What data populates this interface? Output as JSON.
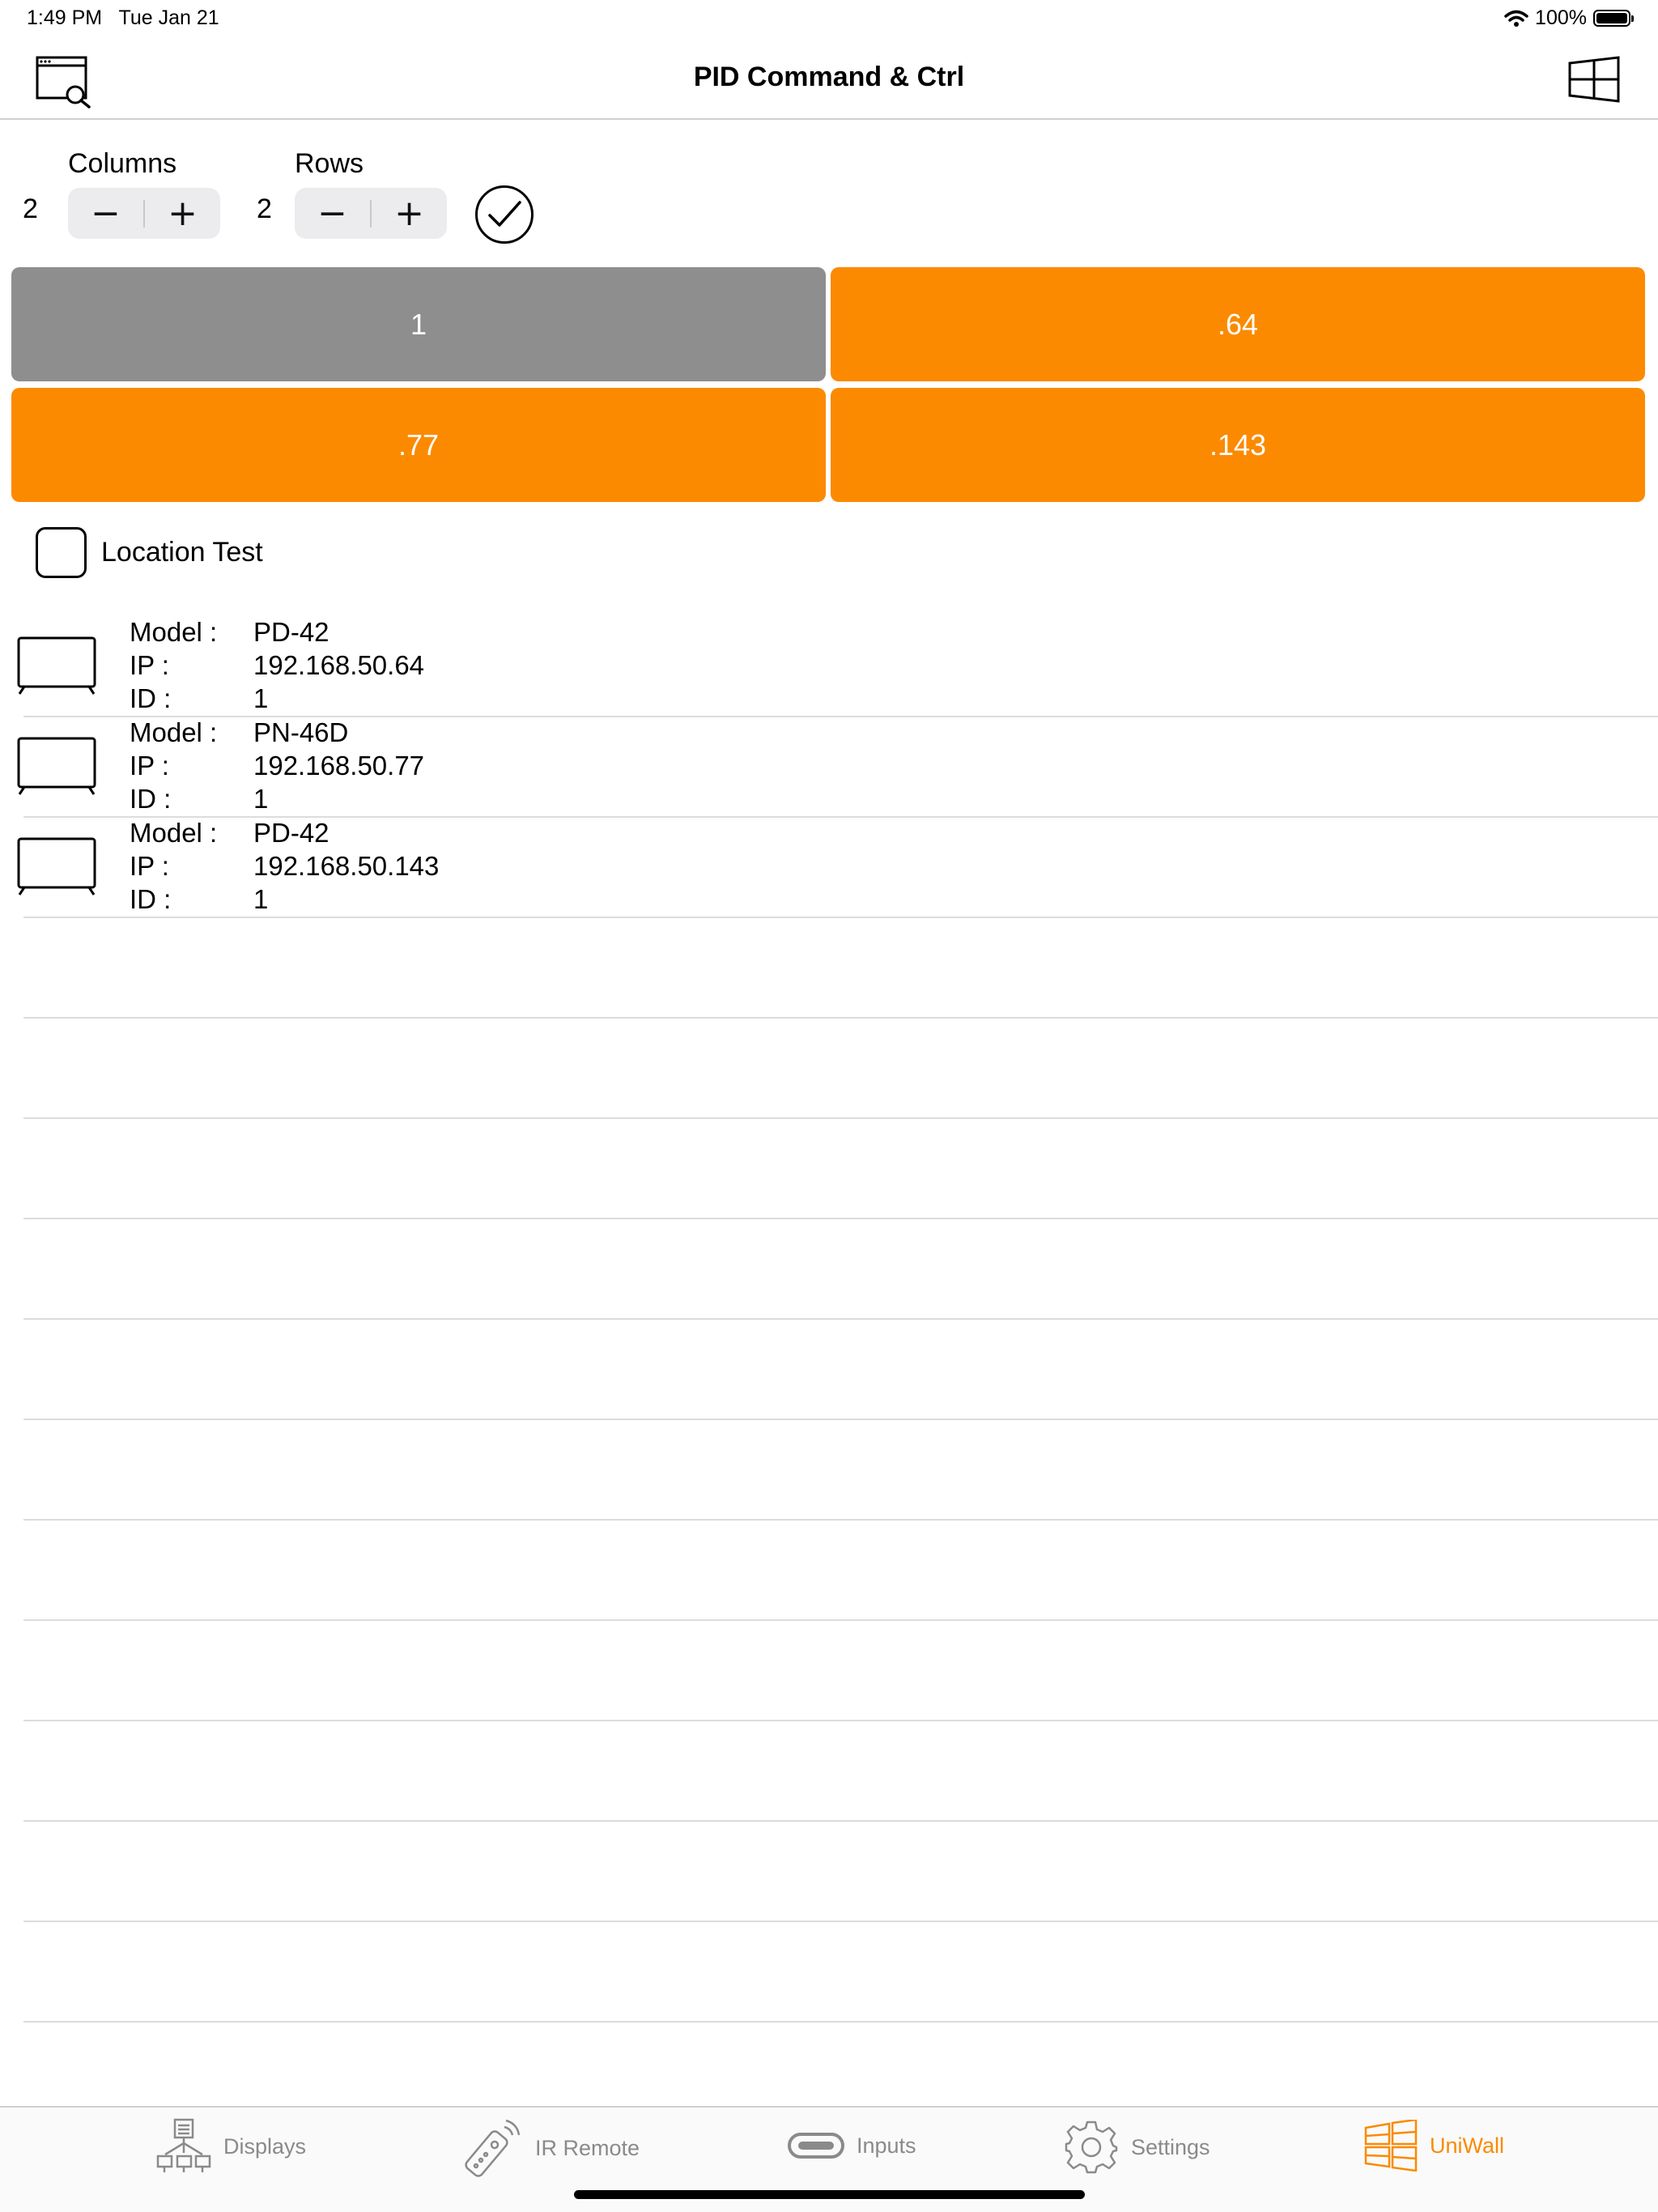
{
  "status": {
    "time": "1:49 PM",
    "date": "Tue Jan 21",
    "battery": "100%"
  },
  "nav": {
    "title": "PID Command & Ctrl",
    "left_icon": "window-search-icon",
    "right_icon": "windows-grid-icon"
  },
  "grid_config": {
    "columns_label": "Columns",
    "columns_value": "2",
    "rows_label": "Rows",
    "rows_value": "2",
    "minus": "−",
    "plus": "+"
  },
  "grid": {
    "cells": [
      {
        "label": "1",
        "color": "#8e8e8e"
      },
      {
        "label": ".64",
        "color": "#fb8a00"
      },
      {
        "label": ".77",
        "color": "#fb8a00"
      },
      {
        "label": ".143",
        "color": "#fb8a00"
      }
    ]
  },
  "location_test": {
    "label": "Location Test",
    "checked": false
  },
  "labels": {
    "model": "Model :",
    "ip": "IP :",
    "id": "ID :"
  },
  "displays": [
    {
      "model": "PD-42",
      "ip": "192.168.50.64",
      "id": "1"
    },
    {
      "model": "PN-46D",
      "ip": "192.168.50.77",
      "id": "1"
    },
    {
      "model": "PD-42",
      "ip": "192.168.50.143",
      "id": "1"
    }
  ],
  "tabs": [
    {
      "label": "Displays",
      "icon": "network-displays-icon",
      "active": false
    },
    {
      "label": "IR Remote",
      "icon": "remote-control-icon",
      "active": false
    },
    {
      "label": "Inputs",
      "icon": "hdmi-port-icon",
      "active": false
    },
    {
      "label": "Settings",
      "icon": "gear-icon",
      "active": false
    },
    {
      "label": "UniWall",
      "icon": "video-wall-icon",
      "active": true
    }
  ],
  "colors": {
    "accent": "#fb8a00",
    "inactive_cell": "#8e8e8e",
    "tab_inactive": "#8a8a8a"
  }
}
